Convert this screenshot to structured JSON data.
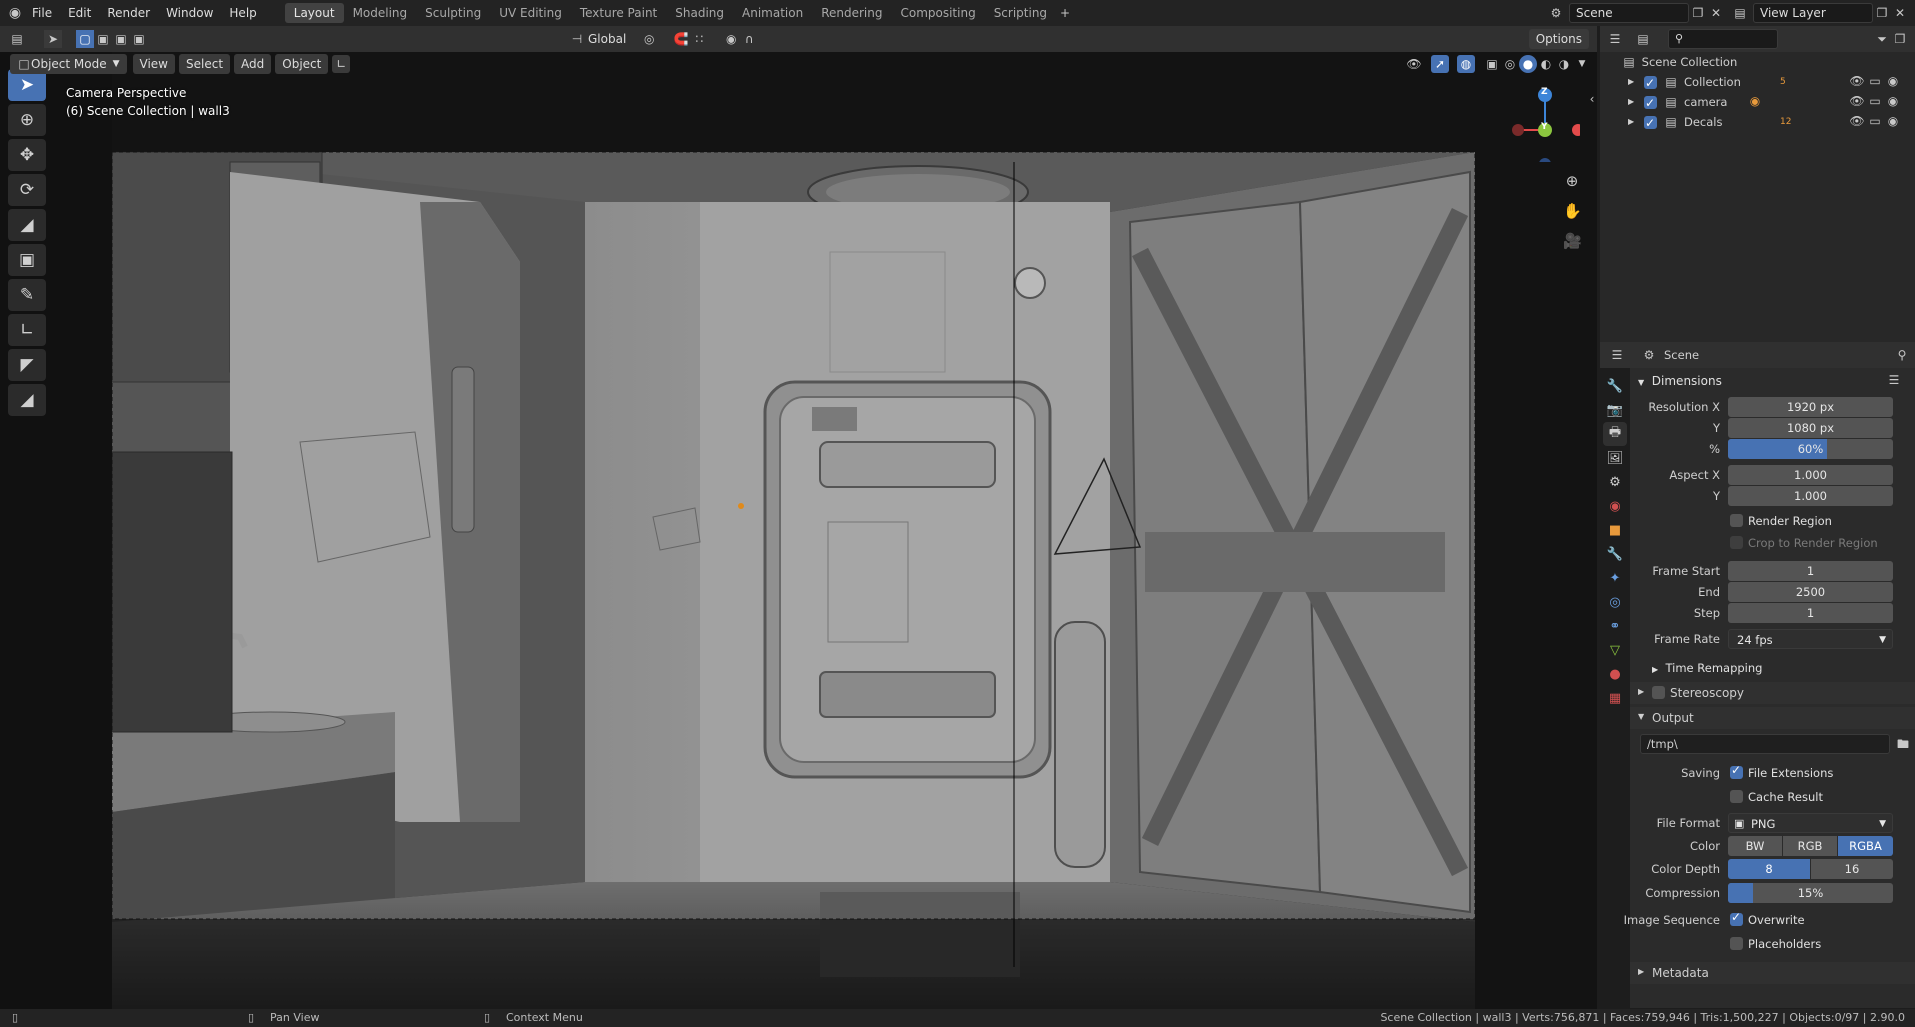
{
  "menu": {
    "file": "File",
    "edit": "Edit",
    "render": "Render",
    "window": "Window",
    "help": "Help"
  },
  "workspaces": [
    "Layout",
    "Modeling",
    "Sculpting",
    "UV Editing",
    "Texture Paint",
    "Shading",
    "Animation",
    "Rendering",
    "Compositing",
    "Scripting"
  ],
  "scene_field": "Scene",
  "view_layer_field": "View Layer",
  "viewport_header": {
    "mode": "Object Mode",
    "view": "View",
    "select": "Select",
    "add": "Add",
    "object": "Object",
    "orientation": "Global",
    "options": "Options"
  },
  "viewport_overlay": {
    "line1": "Camera Perspective",
    "line2": "(6) Scene Collection | wall3"
  },
  "gizmo": {
    "z": "Z",
    "y": "Y"
  },
  "outliner": {
    "root": "Scene Collection",
    "items": [
      {
        "name": "Collection",
        "count": "5"
      },
      {
        "name": "camera"
      },
      {
        "name": "Decals",
        "count": "12"
      }
    ]
  },
  "properties": {
    "header": "Scene",
    "dimensions": {
      "title": "Dimensions",
      "resolution_x_label": "Resolution X",
      "resolution_x": "1920 px",
      "y_label": "Y",
      "resolution_y": "1080 px",
      "percent_label": "%",
      "percent": "60%",
      "percent_fraction": 0.6,
      "aspect_x_label": "Aspect X",
      "aspect_x": "1.000",
      "aspect_y_label": "Y",
      "aspect_y": "1.000",
      "render_region": "Render Region",
      "crop": "Crop to Render Region",
      "frame_start_label": "Frame Start",
      "frame_start": "1",
      "end_label": "End",
      "end": "2500",
      "step_label": "Step",
      "step": "1",
      "frame_rate_label": "Frame Rate",
      "frame_rate": "24 fps",
      "time_remapping": "Time Remapping"
    },
    "stereoscopy": "Stereoscopy",
    "output": {
      "title": "Output",
      "path": "/tmp\\",
      "saving_label": "Saving",
      "file_extensions": "File Extensions",
      "cache_result": "Cache Result",
      "file_format_label": "File Format",
      "file_format": "PNG",
      "color_label": "Color",
      "color_bw": "BW",
      "color_rgb": "RGB",
      "color_rgba": "RGBA",
      "color_depth_label": "Color Depth",
      "depth_8": "8",
      "depth_16": "16",
      "compression_label": "Compression",
      "compression": "15%",
      "compression_fraction": 0.15,
      "image_sequence_label": "Image Sequence",
      "overwrite": "Overwrite",
      "placeholders": "Placeholders"
    },
    "metadata": "Metadata"
  },
  "status": {
    "pan": "Pan View",
    "context": "Context Menu",
    "stats": "Scene Collection | wall3 | Verts:756,871 | Faces:759,946 | Tris:1,500,227 | Objects:0/97 | 2.90.0"
  },
  "colors": {
    "accent": "#4772b3",
    "bg": "#1d1d1d",
    "panel": "#303030",
    "axis_x": "#e34b4b",
    "axis_y": "#8cc63f",
    "axis_z": "#3d85d8"
  }
}
